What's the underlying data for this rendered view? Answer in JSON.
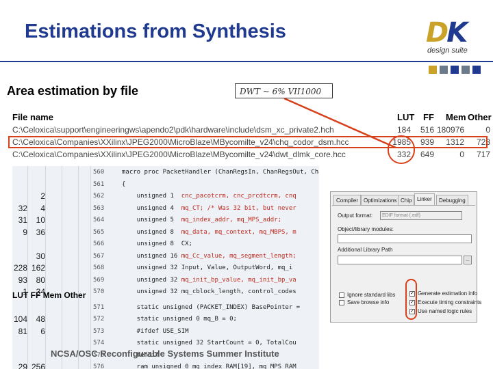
{
  "slide_title": "Estimations from Synthesis",
  "logo": {
    "text_d": "D",
    "text_k": "K",
    "subtitle": "design suite"
  },
  "logo_squares": [
    "#c9a227",
    "#6b7b8c",
    "#1f3a8f",
    "#6b7b8c",
    "#1f3a8f"
  ],
  "section_title": "Area estimation by file",
  "annotation": "DWT ~ 6% VII1000",
  "file_table": {
    "headers": [
      "File name",
      "LUT",
      "FF",
      "Mem",
      "Other"
    ],
    "rows": [
      {
        "name": "C:\\Celoxica\\support\\engineeringws\\apendo2\\pdk\\hardware\\include\\dsm_xc_private2.hch",
        "lut": "184",
        "ff": "516",
        "mem": "180976",
        "other": "0"
      },
      {
        "name": "C:\\Celoxica\\Companies\\XXilinx\\JPEG2000\\MicroBlaze\\MBycomilte_v24\\chq_codor_dsm.hcc",
        "lut": "1985",
        "ff": "939",
        "mem": "1312",
        "other": "728"
      },
      {
        "name": "C:\\Celoxica\\Companies\\XXilinx\\JPEG2000\\MicroBlaze\\MBycomilte_v24\\dwt_dlmk_core.hcc",
        "lut": "332",
        "ff": "649",
        "mem": "0",
        "other": "717"
      }
    ]
  },
  "code_grid": {
    "rows": [
      {
        "c1": "",
        "c2": "",
        "ln": "560",
        "code": "macro proc PacketHandler (ChanRegsIn, ChanRegsOut, ChanDataOut)"
      },
      {
        "c1": "",
        "c2": "",
        "ln": "561",
        "code": "{"
      },
      {
        "c1": "",
        "c2": "2",
        "ln": "562",
        "code": "    unsigned 1  ",
        "red": "cnc_pacotcrm, cnc_prcdtcrm, cnq"
      },
      {
        "c1": "32",
        "c2": "4",
        "ln": "563",
        "code": "    unsigned 4  ",
        "red": "mq_CT; /* Was 32 bit, but never"
      },
      {
        "c1": "31",
        "c2": "10",
        "ln": "564",
        "code": "    unsigned 5  ",
        "red": "mq_index_addr, mq_MPS_addr;"
      },
      {
        "c1": "9",
        "c2": "36",
        "ln": "565",
        "code": "    unsigned 8  ",
        "red": "mq_data, mq_context, mq_MBPS, m"
      },
      {
        "c1": "",
        "c2": "",
        "ln": "566",
        "code": "    unsigned 8  CX;"
      },
      {
        "c1": "",
        "c2": "30",
        "ln": "567",
        "code": "    unsigned 16 ",
        "red": "mq_Cc_value, mq_segment_length;"
      },
      {
        "c1": "228",
        "c2": "162",
        "ln": "568",
        "code": "    unsigned 32 Input, Value, OutputWord, mq_i"
      },
      {
        "c1": "93",
        "c2": "80",
        "ln": "569",
        "code": "    unsigned 32 ",
        "red": "mq_init_bp_value, mq_init_bp_va"
      },
      {
        "c1": "1",
        "c2": "34",
        "ln": "570",
        "code": "    unsigned 32 mq_cblock_length, control_codes"
      },
      {
        "c1": "",
        "c2": "",
        "ln": "571",
        "code": "    static unsigned (PACKET_INDEX) BasePointer ="
      },
      {
        "c1": "104",
        "c2": "48",
        "ln": "572",
        "code": "    static unsigned 0 mq_B = 0;"
      },
      {
        "c1": "81",
        "c2": "6",
        "ln": "573",
        "code": "    #ifdef USE_SIM"
      },
      {
        "c1": "",
        "c2": "",
        "ln": "574",
        "code": "    static unsigned 32 StartCount = 0, TotalCou"
      },
      {
        "c1": "",
        "c2": "",
        "ln": "575",
        "code": "    #endif"
      },
      {
        "c1": "29",
        "c2": "256",
        "ln": "576",
        "code": "    ram unsigned 0 mq_index_RAM[19], mq_MPS_RAM"
      }
    ],
    "sub_headers": [
      "LUT",
      "FF",
      "Mem",
      "Other"
    ]
  },
  "dialog": {
    "tabs": [
      "Compiler",
      "Optimizations",
      "Chip",
      "Linker",
      "Debugging"
    ],
    "output_format_label": "Output format:",
    "output_format_value": "EDIF format (.edf)",
    "object_label": "Object/library modules:",
    "additional_label": "Additional Library Path",
    "browse": "...",
    "checks_left": [
      "Ignore standard libs",
      "Save browse info"
    ],
    "checks_right": [
      "Generate estimation info",
      "Execute timing constraints",
      "Use named logic rules"
    ]
  },
  "footer": "NCSA/OSC Reconfigurable Systems Summer Institute"
}
